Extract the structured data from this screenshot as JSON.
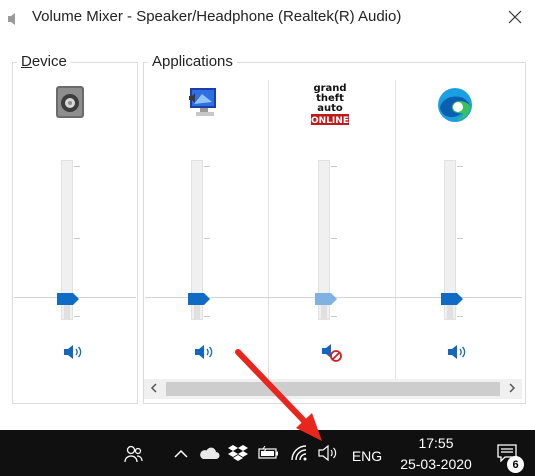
{
  "window": {
    "title": "Volume Mixer - Speaker/Headphone (Realtek(R) Audio)",
    "close_icon": "close-icon"
  },
  "groups": {
    "device_label_first": "D",
    "device_label_rest": "evice",
    "applications_label": "Applications"
  },
  "columns": [
    {
      "id": "speaker",
      "icon": "speaker-device-icon",
      "level": 0.15,
      "muted": false
    },
    {
      "id": "system-sounds",
      "icon": "system-sounds-icon",
      "level": 0.15,
      "muted": false
    },
    {
      "id": "gta-online",
      "icon": "gta-online-icon",
      "logo_text": [
        "grand",
        "theft",
        "auto",
        "ONLINE"
      ],
      "level": 0.15,
      "muted": true
    },
    {
      "id": "edge",
      "icon": "edge-browser-icon",
      "level": 0.15,
      "muted": false
    }
  ],
  "taskbar": {
    "language": "ENG",
    "time": "17:55",
    "date": "25-03-2020",
    "notification_count": "6"
  },
  "colors": {
    "accent": "#0f6cc4",
    "taskbar_bg": "#101010",
    "annotation_arrow": "#e8261e"
  }
}
